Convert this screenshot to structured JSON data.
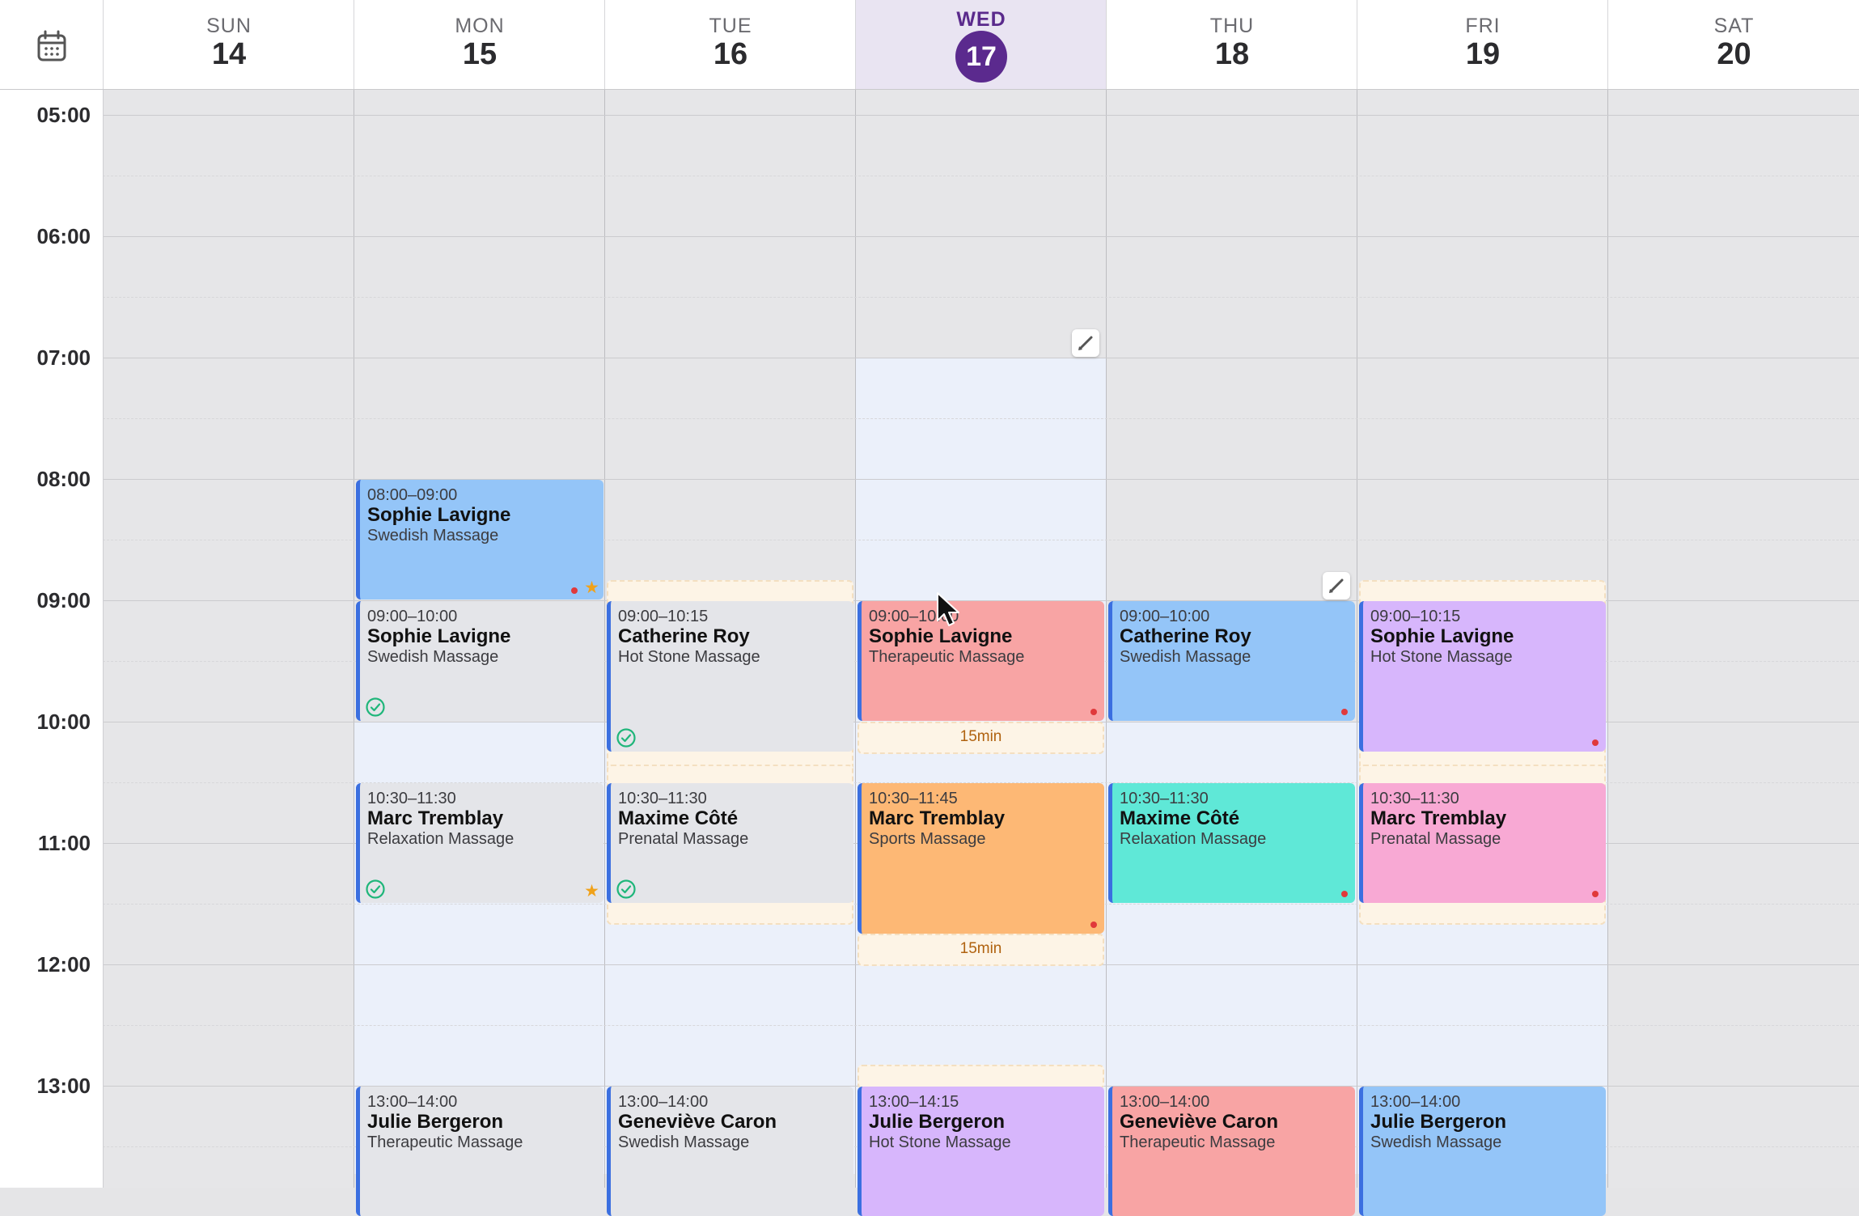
{
  "header": {
    "days": [
      {
        "name": "SUN",
        "num": "14"
      },
      {
        "name": "MON",
        "num": "15"
      },
      {
        "name": "TUE",
        "num": "16"
      },
      {
        "name": "WED",
        "num": "17",
        "today": true
      },
      {
        "name": "THU",
        "num": "18"
      },
      {
        "name": "FRI",
        "num": "19"
      },
      {
        "name": "SAT",
        "num": "20"
      }
    ]
  },
  "times": [
    "05:00",
    "06:00",
    "07:00",
    "08:00",
    "09:00",
    "10:00",
    "11:00",
    "12:00",
    "13:00"
  ],
  "events": {
    "mon_1": {
      "time": "08:00–09:00",
      "name": "Sophie Lavigne",
      "service": "Swedish Massage"
    },
    "mon_2": {
      "time": "09:00–10:00",
      "name": "Sophie Lavigne",
      "service": "Swedish Massage"
    },
    "mon_3": {
      "time": "10:30–11:30",
      "name": "Marc Tremblay",
      "service": "Relaxation Massage"
    },
    "mon_4": {
      "time": "13:00–14:00",
      "name": "Julie Bergeron",
      "service": "Therapeutic Massage"
    },
    "tue_1": {
      "time": "09:00–10:15",
      "name": "Catherine Roy",
      "service": "Hot Stone Massage"
    },
    "tue_2": {
      "time": "10:30–11:30",
      "name": "Maxime Côté",
      "service": "Prenatal Massage"
    },
    "tue_3": {
      "time": "13:00–14:00",
      "name": "Geneviève Caron",
      "service": "Swedish Massage"
    },
    "wed_1": {
      "time": "09:00–10:00",
      "name": "Sophie Lavigne",
      "service": "Therapeutic Massage"
    },
    "wed_2": {
      "time": "10:30–11:45",
      "name": "Marc Tremblay",
      "service": "Sports Massage"
    },
    "wed_3": {
      "time": "13:00–14:15",
      "name": "Julie Bergeron",
      "service": "Hot Stone Massage"
    },
    "thu_1": {
      "time": "09:00–10:00",
      "name": "Catherine Roy",
      "service": "Swedish Massage"
    },
    "thu_2": {
      "time": "10:30–11:30",
      "name": "Maxime Côté",
      "service": "Relaxation Massage"
    },
    "thu_3": {
      "time": "13:00–14:00",
      "name": "Geneviève Caron",
      "service": "Therapeutic Massage"
    },
    "fri_1": {
      "time": "09:00–10:15",
      "name": "Sophie Lavigne",
      "service": "Hot Stone Massage"
    },
    "fri_2": {
      "time": "10:30–11:30",
      "name": "Marc Tremblay",
      "service": "Prenatal Massage"
    },
    "fri_3": {
      "time": "13:00–14:00",
      "name": "Julie Bergeron",
      "service": "Swedish Massage"
    }
  },
  "buffers": {
    "wed_a": "15min",
    "wed_b": "15min"
  },
  "colors": {
    "today": "#5b2a8e",
    "blue": "#94c5f8",
    "gray": "#e4e5e9",
    "red": "#f8a4a4",
    "orange": "#fdb875",
    "teal": "#5fe8d7",
    "purple": "#d7b6fc",
    "pink": "#f8a9d4",
    "status_dot": "#e0393b",
    "check": "#1fb67a",
    "star": "#f0a21a"
  },
  "icons": [
    "calendar-icon",
    "edit-pencil-icon",
    "check-circle-icon",
    "star-icon",
    "mouse-cursor-icon"
  ]
}
